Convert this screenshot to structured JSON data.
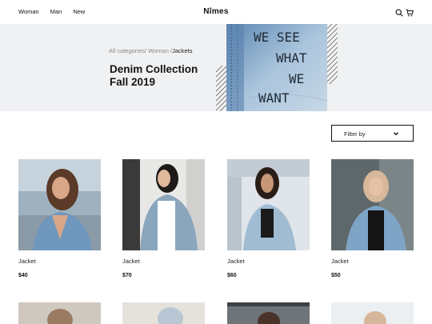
{
  "nav": {
    "items": [
      "Woman",
      "Man",
      "New"
    ]
  },
  "brand": {
    "name": "Nîmes"
  },
  "icons": {
    "search": "search-icon",
    "cart": "cart-icon"
  },
  "hero": {
    "breadcrumb": {
      "first": "All categories/",
      "second": " Woman /",
      "current": "Jackets"
    },
    "title_line1": "Denim Collection",
    "title_line2": "Fall 2019",
    "image_text": [
      "WE SEE",
      "WHAT",
      "WE",
      "WANT"
    ]
  },
  "filter": {
    "label": "Filter by",
    "icon": "chevron-down-icon"
  },
  "products": [
    {
      "name": "Jacket",
      "price": "$40"
    },
    {
      "name": "Jacket",
      "price": "$70"
    },
    {
      "name": "Jacket",
      "price": "$60"
    },
    {
      "name": "Jacket",
      "price": "$50"
    }
  ],
  "colors": {
    "hero_bg": "#f0f1f3",
    "denim": "#7fa6c8",
    "text": "#111111"
  }
}
